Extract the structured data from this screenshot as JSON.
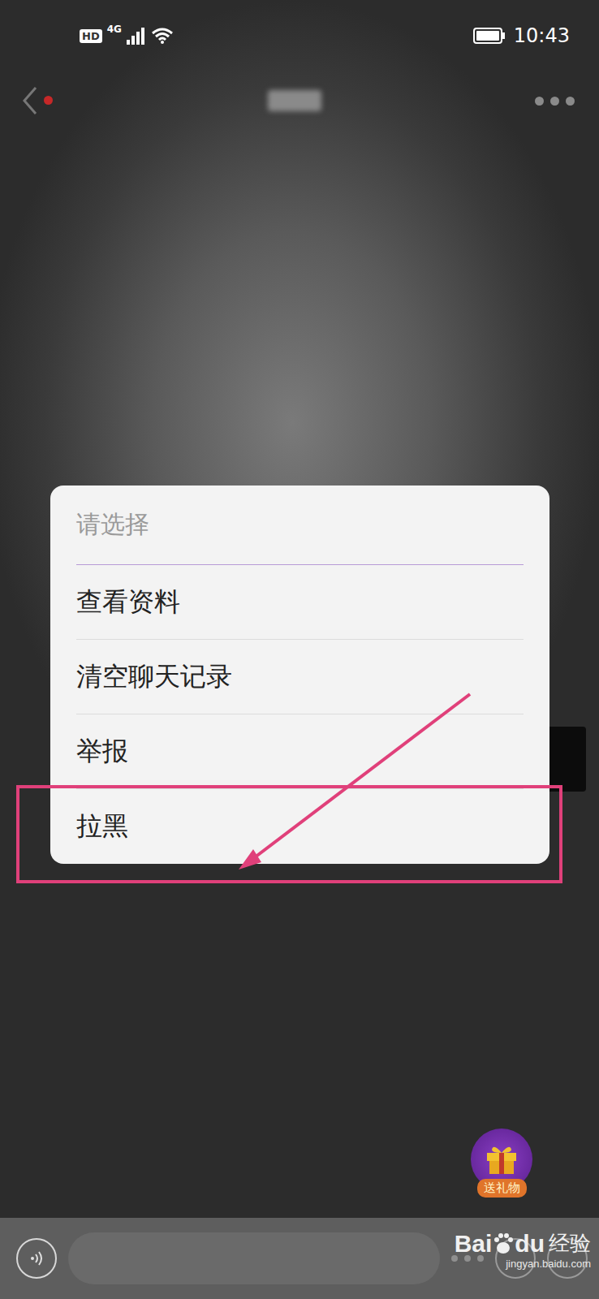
{
  "status_bar": {
    "hd": "HD",
    "network": "4G",
    "time": "10:43"
  },
  "header": {
    "unread_dot": true
  },
  "dialog": {
    "title": "请选择",
    "items": [
      {
        "label": "查看资料",
        "highlighted": false
      },
      {
        "label": "清空聊天记录",
        "highlighted": false
      },
      {
        "label": "举报",
        "highlighted": false
      },
      {
        "label": "拉黑",
        "highlighted": true
      }
    ]
  },
  "gift_button": {
    "label": "送礼物"
  },
  "watermark": {
    "brand": "Bai",
    "brand_suffix": "du",
    "product": "经验",
    "url": "jingyan.baidu.com"
  }
}
